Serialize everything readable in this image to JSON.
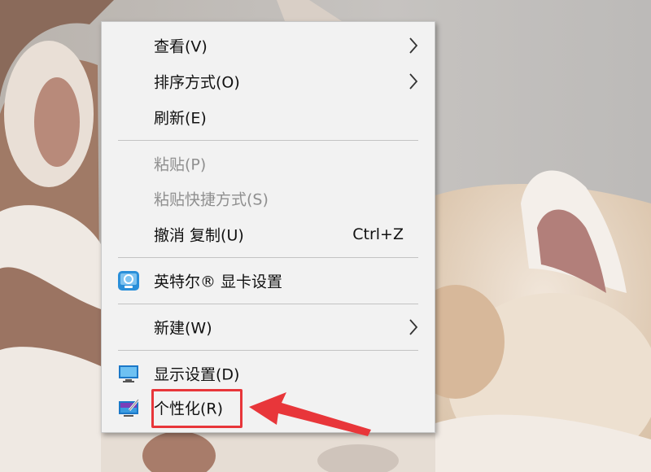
{
  "context_menu": {
    "items": [
      {
        "label": "查看(V)",
        "has_submenu": true
      },
      {
        "label": "排序方式(O)",
        "has_submenu": true
      },
      {
        "label": "刷新(E)"
      },
      {
        "label": "粘贴(P)",
        "disabled": true
      },
      {
        "label": "粘贴快捷方式(S)",
        "disabled": true
      },
      {
        "label": "撤消 复制(U)",
        "shortcut": "Ctrl+Z"
      },
      {
        "label": "英特尔® 显卡设置",
        "icon": "intel-graphics-icon"
      },
      {
        "label": "新建(W)",
        "has_submenu": true
      },
      {
        "label": "显示设置(D)",
        "icon": "monitor-icon"
      },
      {
        "label": "个性化(R)",
        "icon": "personalize-icon",
        "highlighted": true
      }
    ]
  },
  "annotation": {
    "highlight_color": "#e8363a",
    "arrow_color": "#e8363a"
  },
  "colors": {
    "menu_bg": "#f2f2f2",
    "disabled_text": "#8f8f8f",
    "separator": "#c3c3c3"
  }
}
